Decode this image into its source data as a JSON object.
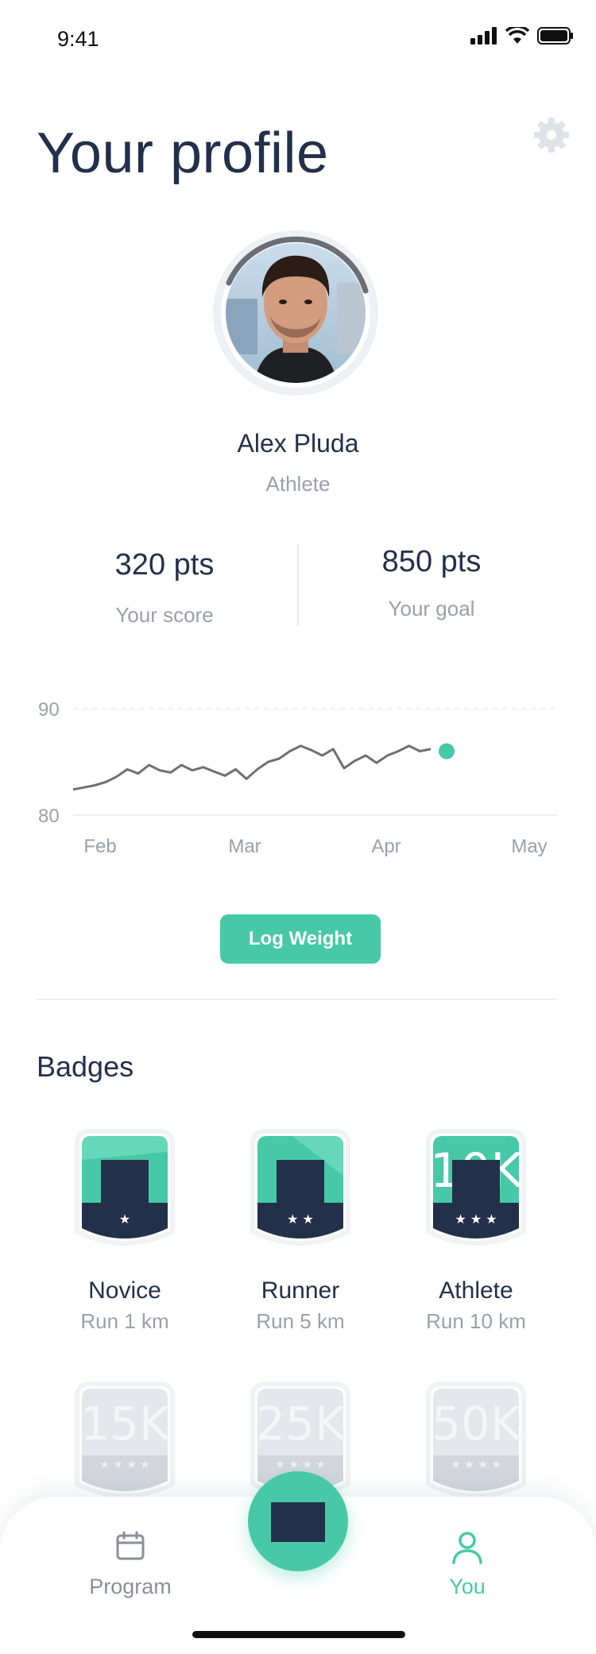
{
  "status_bar": {
    "time": "9:41"
  },
  "header": {
    "title": "Your profile",
    "settings_icon": "gear-icon"
  },
  "profile": {
    "name": "Alex Pluda",
    "role": "Athlete"
  },
  "stats": [
    {
      "value": "320 pts",
      "label": "Your score"
    },
    {
      "value": "850 pts",
      "label": "Your goal"
    }
  ],
  "chart_data": {
    "type": "line",
    "x_ticks": [
      "Feb",
      "Mar",
      "Apr",
      "May"
    ],
    "y_ticks": [
      "90",
      "80"
    ],
    "ylim": [
      80,
      90
    ],
    "series": [
      {
        "values": [
          82.4,
          82.6,
          82.8,
          83.1,
          83.6,
          84.3,
          83.9,
          84.7,
          84.2,
          84.0,
          84.7,
          84.2,
          84.5,
          84.1,
          83.7,
          84.3,
          83.4,
          84.3,
          85.0,
          85.3,
          86.0,
          86.5,
          86.1,
          85.6,
          86.2,
          84.4,
          85.1,
          85.6,
          84.9,
          85.6,
          86.0,
          86.5,
          86.0,
          86.2
        ]
      }
    ],
    "current_marker": 86.0,
    "grid": true,
    "accent": "#47c9a7",
    "line_color": "#707070"
  },
  "actions": {
    "log_weight": "Log Weight"
  },
  "badges_section": {
    "title": "Badges",
    "earned": [
      {
        "name": "Novice",
        "sub": "Run 1 km",
        "stars": 1
      },
      {
        "name": "Runner",
        "sub": "Run 5 km",
        "stars": 2
      },
      {
        "name": "Athlete",
        "sub": "Run 10 km",
        "stars": 3,
        "bg_text": "10K"
      }
    ],
    "locked": [
      {
        "bg_text": "15K"
      },
      {
        "bg_text": "25K"
      },
      {
        "bg_text": "50K"
      }
    ]
  },
  "tab_bar": {
    "program": "Program",
    "you": "You",
    "active": "you",
    "colors": {
      "active": "#47c9a7",
      "inactive": "#8a8f99"
    }
  }
}
